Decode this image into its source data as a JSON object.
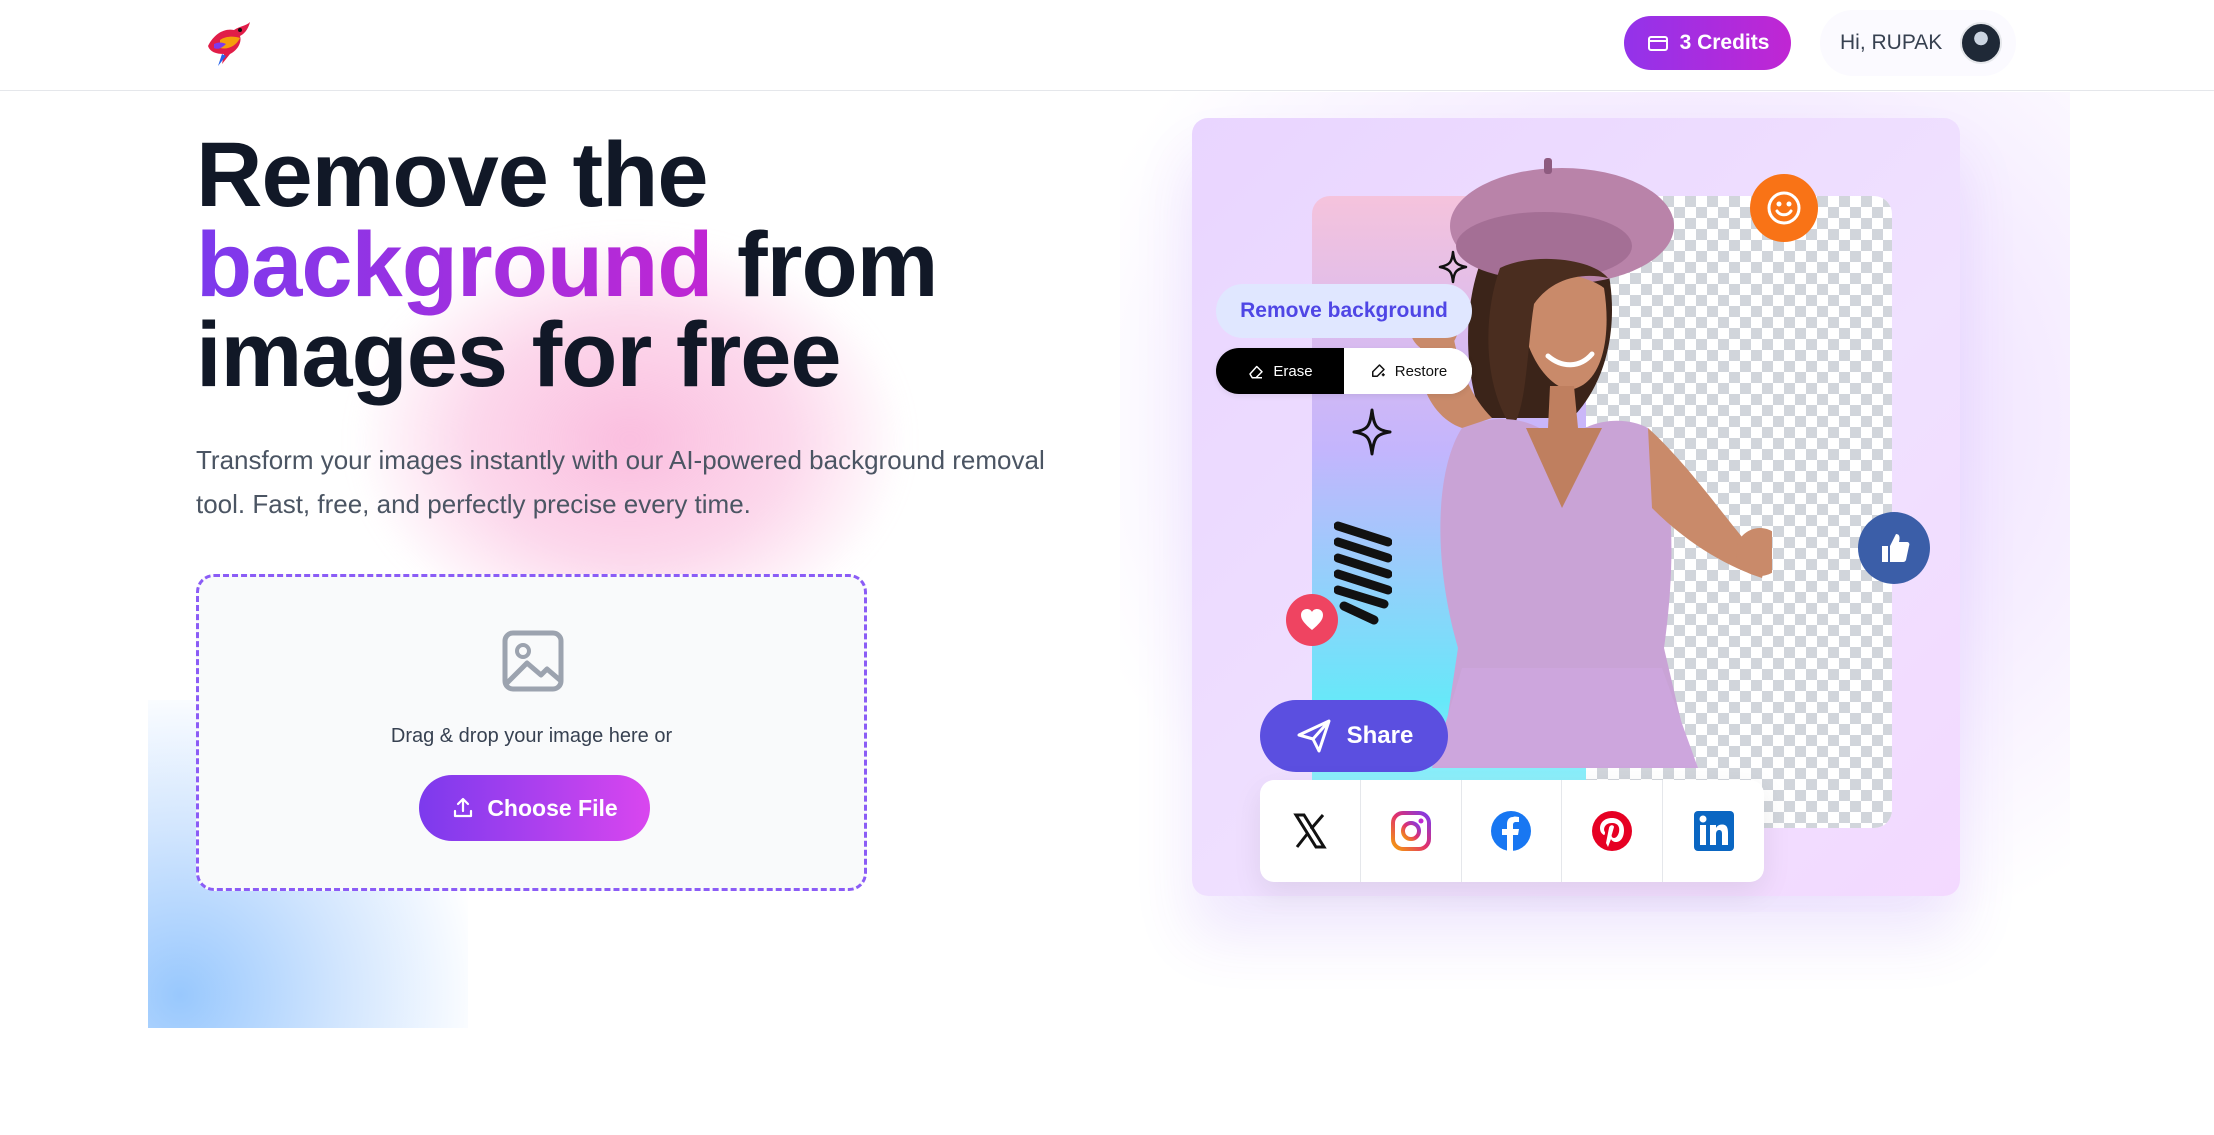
{
  "header": {
    "credits_label": "3 Credits",
    "greeting": "Hi, RUPAK"
  },
  "hero": {
    "title_line1": "Remove the",
    "title_highlight": "background",
    "title_line2_rest": " from",
    "title_line3": "images for free",
    "subtitle": "Transform your images instantly with our AI-powered background removal tool. Fast, free, and perfectly precise every time."
  },
  "dropzone": {
    "text": "Drag & drop your image here or",
    "button_label": "Choose File"
  },
  "showcase": {
    "remove_bg_label": "Remove background",
    "erase_label": "Erase",
    "restore_label": "Restore",
    "share_label": "Share",
    "social_icons": [
      "x-icon",
      "instagram-icon",
      "facebook-icon",
      "pinterest-icon",
      "linkedin-icon"
    ]
  },
  "colors": {
    "accent": "#9333ea",
    "accent_end": "#c026d3",
    "share_blue": "#5b4fe0",
    "text_dark": "#111827"
  }
}
